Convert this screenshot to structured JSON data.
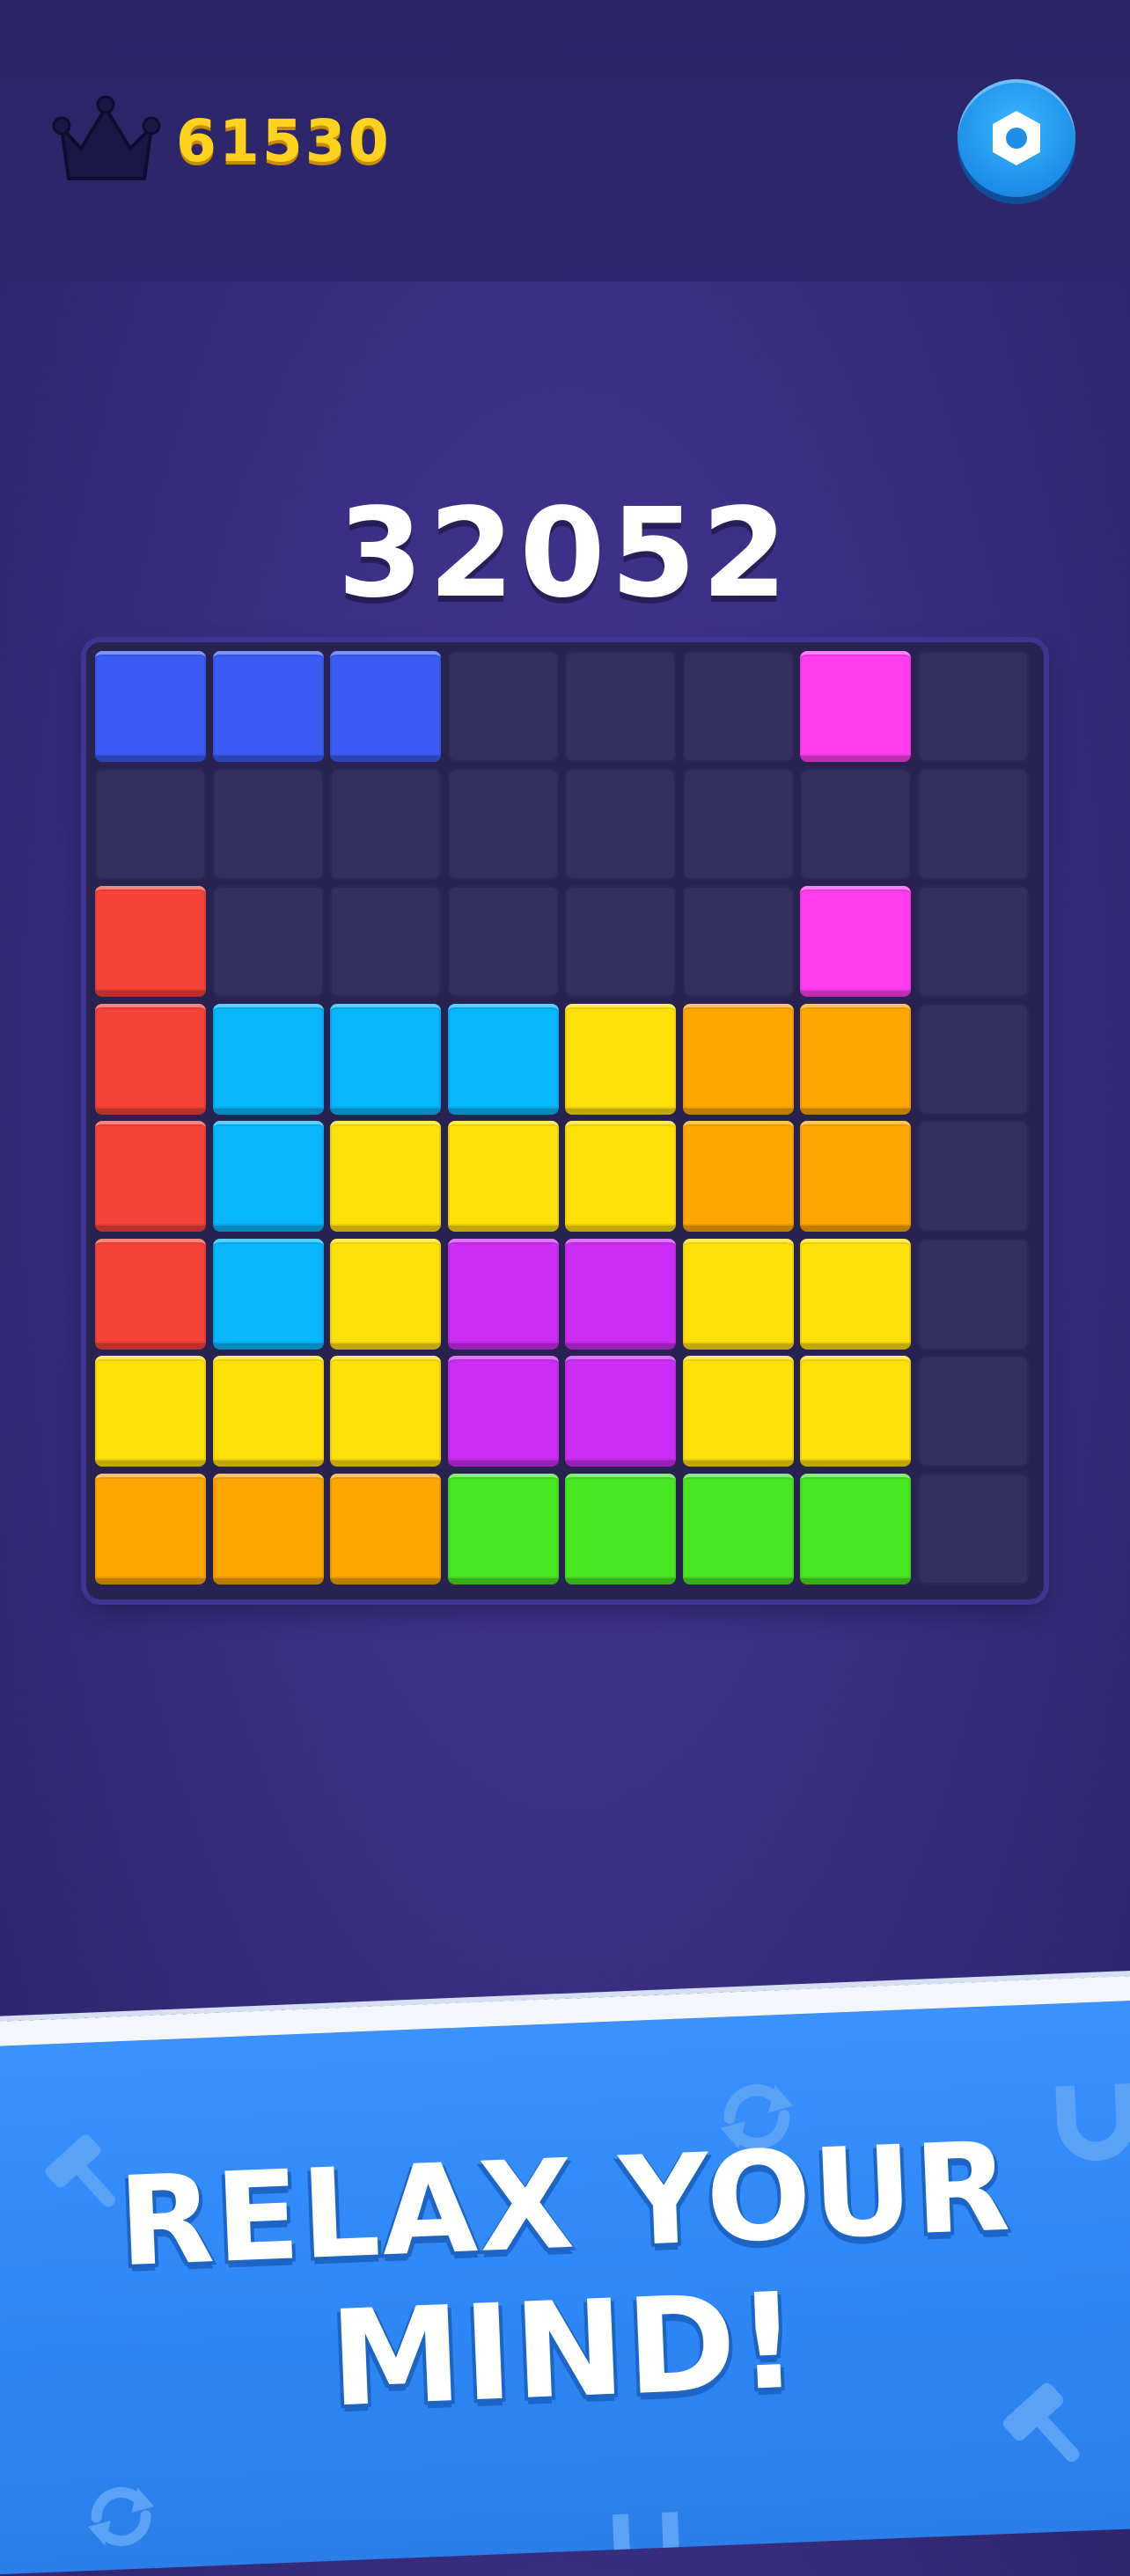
{
  "header": {
    "best_score": "61530",
    "crown_icon": "crown-icon",
    "settings_icon": "hex-nut-settings-icon"
  },
  "current_score": "32052",
  "board": {
    "rows": 8,
    "cols": 8,
    "palette": {
      "E": "empty",
      "B": "#3a5cf5",
      "P": "#ff3cf0",
      "R": "#f5433a",
      "C": "#07b6fb",
      "Y": "#ffe10a",
      "O": "#ffa700",
      "V": "#cc2df5",
      "G": "#48e722"
    },
    "grid": [
      [
        "B",
        "B",
        "B",
        "E",
        "E",
        "E",
        "P",
        "E"
      ],
      [
        "E",
        "E",
        "E",
        "E",
        "E",
        "E",
        "E",
        "E"
      ],
      [
        "R",
        "E",
        "E",
        "E",
        "E",
        "E",
        "P",
        "E"
      ],
      [
        "R",
        "C",
        "C",
        "C",
        "Y",
        "O",
        "O",
        "E"
      ],
      [
        "R",
        "C",
        "Y",
        "Y",
        "Y",
        "O",
        "O",
        "E"
      ],
      [
        "R",
        "C",
        "Y",
        "V",
        "V",
        "Y",
        "Y",
        "E"
      ],
      [
        "Y",
        "Y",
        "Y",
        "V",
        "V",
        "Y",
        "Y",
        "E"
      ],
      [
        "O",
        "O",
        "O",
        "G",
        "G",
        "G",
        "G",
        "E"
      ]
    ]
  },
  "banner": {
    "line1": "RELAX YOUR",
    "line2": "MIND!",
    "decor_icons": [
      "hammer-icon",
      "refresh-icon",
      "magnet-icon",
      "hammer-icon",
      "refresh-icon",
      "magnet-icon"
    ]
  }
}
